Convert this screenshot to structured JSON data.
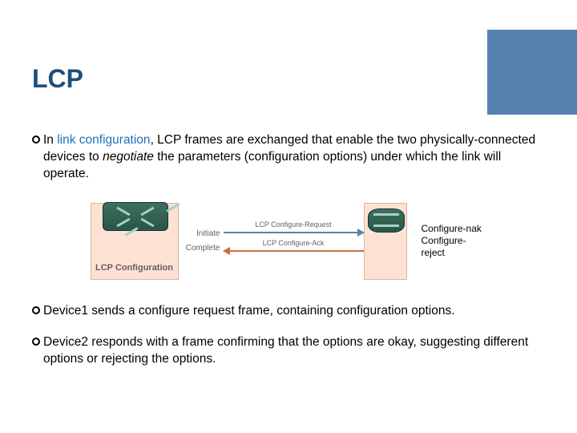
{
  "title": "LCP",
  "bullets": {
    "intro_prefix": "In ",
    "intro_link": "link configuration",
    "intro_rest": ", LCP frames are exchanged that enable the two physically-connected devices to ",
    "intro_italic": "negotiate",
    "intro_tail": " the parameters (configuration options) under which the link will operate.",
    "dev1": "Device1 sends a configure request frame, containing configuration options.",
    "dev2": "Device2 responds with a frame confirming that the options are okay, suggesting different options or rejecting the options."
  },
  "diagram": {
    "lcp_label": "LCP Configuration",
    "state_initiate": "Initiate",
    "state_complete": "Complete",
    "req_label": "LCP Configure-Request",
    "ack_label": "LCP Configure-Ack",
    "annotation_nak": "Configure-nak",
    "annotation_reject": "Configure-reject"
  }
}
